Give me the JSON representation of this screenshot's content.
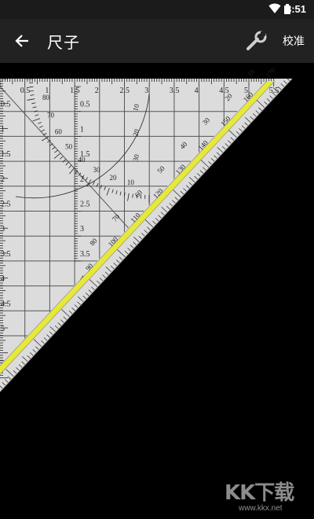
{
  "status_bar": {
    "time": "8:51",
    "icons": [
      "wifi-icon",
      "battery-icon"
    ]
  },
  "app_bar": {
    "title": "尺子",
    "back_icon": "arrow-back-icon",
    "wrench_icon": "wrench-icon",
    "calibrate_label": "校准",
    "background": "#222222"
  },
  "ruler": {
    "top_scale_labels": [
      "0.5",
      "1",
      "1.5",
      "2",
      "2.5",
      "3",
      "3.5",
      "4",
      "4.5",
      "5",
      "5.5"
    ],
    "left_scale_labels": [
      "0.5",
      "1",
      "1.5",
      "2",
      "2.5",
      "3",
      "3.5",
      "4",
      "4.5",
      "5"
    ],
    "inner_scale_labels": [
      "0.5",
      "1",
      "1.5",
      "2",
      "2.5",
      "3",
      "3.5",
      "4"
    ],
    "protractor_labels": [
      "10",
      "20",
      "30",
      "40",
      "50",
      "60",
      "70",
      "80"
    ],
    "protractor_right_labels": [
      "10",
      "20",
      "30"
    ],
    "diagonal_scale_labels": [
      "90",
      "100",
      "110",
      "120",
      "130",
      "140",
      "150",
      "160",
      "170"
    ],
    "diagonal_inner_labels": [
      "80",
      "70",
      "60",
      "50",
      "40",
      "30",
      "20",
      "10"
    ],
    "colors": {
      "ruler_fill": "#dcdcdc",
      "grid_line": "#555555",
      "highlight_band": "#e6e83a",
      "tick": "#222222"
    }
  },
  "watermark": {
    "logo_text": "KK下载",
    "url_text": "www.kkx.net"
  }
}
